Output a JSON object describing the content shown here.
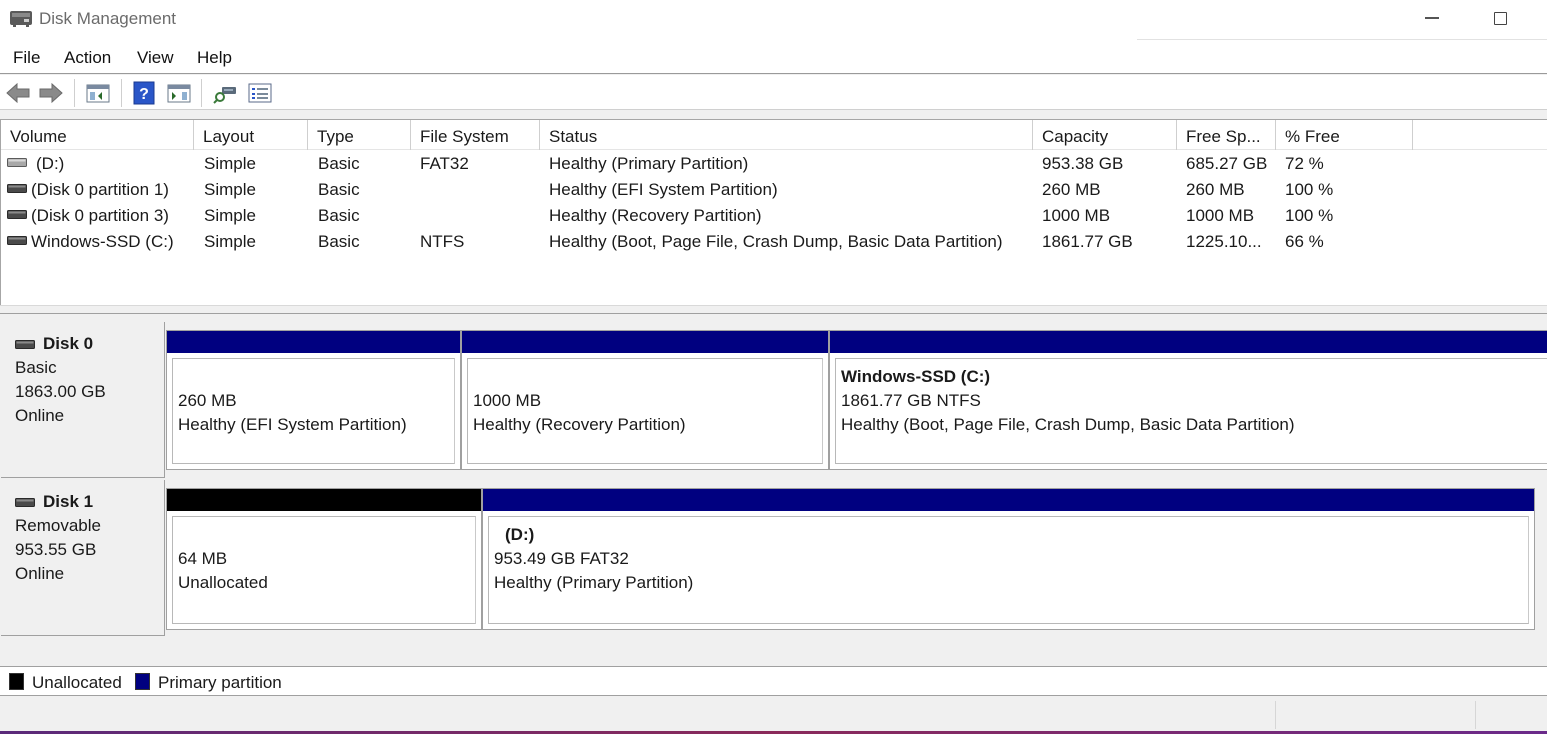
{
  "window": {
    "title": "Disk Management"
  },
  "menu": [
    "File",
    "Action",
    "View",
    "Help"
  ],
  "toolbar": {
    "icons": [
      "back-arrow-icon",
      "forward-arrow-icon",
      "show-hide-console-tree-icon",
      "help-icon",
      "show-hide-action-pane-icon",
      "rescan-disks-icon",
      "properties-icon"
    ]
  },
  "volume_table": {
    "columns": [
      "Volume",
      "Layout",
      "Type",
      "File System",
      "Status",
      "Capacity",
      "Free Sp...",
      "% Free"
    ],
    "rows": [
      {
        "volume": "(D:)",
        "layout": "Simple",
        "type": "Basic",
        "fs": "FAT32",
        "status": "Healthy (Primary Partition)",
        "capacity": "953.38 GB",
        "free": "685.27 GB",
        "pct": "72 %"
      },
      {
        "volume": "(Disk 0 partition 1)",
        "layout": "Simple",
        "type": "Basic",
        "fs": "",
        "status": "Healthy (EFI System Partition)",
        "capacity": "260 MB",
        "free": "260 MB",
        "pct": "100 %"
      },
      {
        "volume": "(Disk 0 partition 3)",
        "layout": "Simple",
        "type": "Basic",
        "fs": "",
        "status": "Healthy (Recovery Partition)",
        "capacity": "1000 MB",
        "free": "1000 MB",
        "pct": "100 %"
      },
      {
        "volume": "Windows-SSD (C:)",
        "layout": "Simple",
        "type": "Basic",
        "fs": "NTFS",
        "status": "Healthy (Boot, Page File, Crash Dump, Basic Data Partition)",
        "capacity": "1861.77 GB",
        "free": "1225.10...",
        "pct": "66 %"
      }
    ]
  },
  "disks": [
    {
      "name": "Disk 0",
      "kind": "Basic",
      "size": "1863.00 GB",
      "state": "Online",
      "partitions": [
        {
          "title": "",
          "line1": "260 MB",
          "line2": "Healthy (EFI System Partition)",
          "kind": "primary"
        },
        {
          "title": "",
          "line1": "1000 MB",
          "line2": "Healthy (Recovery Partition)",
          "kind": "primary"
        },
        {
          "title": "Windows-SSD  (C:)",
          "line1": "1861.77 GB NTFS",
          "line2": "Healthy (Boot, Page File, Crash Dump, Basic Data Partition)",
          "kind": "primary"
        }
      ]
    },
    {
      "name": "Disk 1",
      "kind": "Removable",
      "size": "953.55 GB",
      "state": "Online",
      "partitions": [
        {
          "title": "",
          "line1": "64 MB",
          "line2": "Unallocated",
          "kind": "unallocated"
        },
        {
          "title": "(D:)",
          "line1": "953.49 GB FAT32",
          "line2": "Healthy (Primary Partition)",
          "kind": "primary"
        }
      ]
    }
  ],
  "legend": [
    {
      "label": "Unallocated",
      "color": "#000000"
    },
    {
      "label": "Primary partition",
      "color": "#000080"
    }
  ],
  "colors": {
    "primary_partition": "#000080",
    "unallocated": "#000000"
  }
}
